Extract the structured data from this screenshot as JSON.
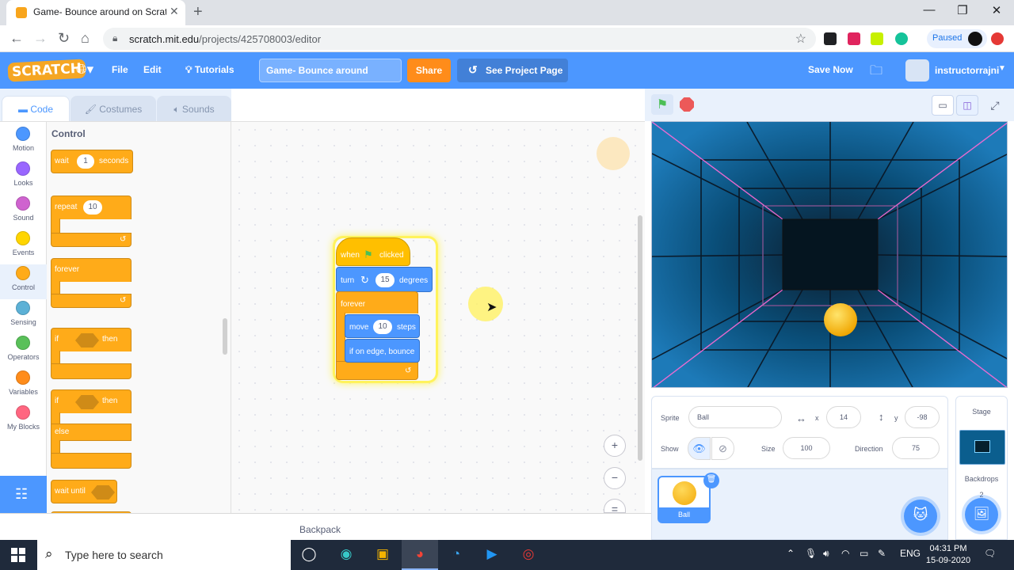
{
  "browser": {
    "tab_title": "Game- Bounce around on Scratch",
    "url_host": "scratch.mit.edu",
    "url_path": "/projects/425708003/editor",
    "profile_status": "Paused"
  },
  "menubar": {
    "logo": "SCRATCH",
    "file": "File",
    "edit": "Edit",
    "tutorials": "Tutorials",
    "project_title": "Game- Bounce around",
    "share": "Share",
    "see_project_page": "See Project Page",
    "save_now": "Save Now",
    "username": "instructorrajni"
  },
  "editor_tabs": {
    "code": "Code",
    "costumes": "Costumes",
    "sounds": "Sounds"
  },
  "categories": [
    {
      "label": "Motion",
      "color": "#4c97ff"
    },
    {
      "label": "Looks",
      "color": "#9966ff"
    },
    {
      "label": "Sound",
      "color": "#cf63cf"
    },
    {
      "label": "Events",
      "color": "#ffd500"
    },
    {
      "label": "Control",
      "color": "#ffab19"
    },
    {
      "label": "Sensing",
      "color": "#5cb1d6"
    },
    {
      "label": "Operators",
      "color": "#59c059"
    },
    {
      "label": "Variables",
      "color": "#ff8c1a"
    },
    {
      "label": "My Blocks",
      "color": "#ff6680"
    }
  ],
  "palette": {
    "heading": "Control",
    "wait": {
      "pre": "wait",
      "value": "1",
      "post": "seconds"
    },
    "repeat": {
      "label": "repeat",
      "value": "10"
    },
    "forever": "forever",
    "if_then": {
      "if": "if",
      "then": "then"
    },
    "if_else": {
      "if": "if",
      "then": "then",
      "else": "else"
    },
    "wait_until": "wait until"
  },
  "script": {
    "when_pre": "when",
    "when_post": "clicked",
    "turn_label": "turn",
    "turn_value": "15",
    "turn_unit": "degrees",
    "forever_label": "forever",
    "move_label": "move",
    "move_value": "10",
    "move_unit": "steps",
    "bounce_label": "if on edge, bounce"
  },
  "zoom": {
    "in": "+",
    "out": "−",
    "reset": "="
  },
  "backpack": "Backpack",
  "sprite_info": {
    "sprite_label": "Sprite",
    "sprite_name": "Ball",
    "x_label": "x",
    "x_value": "14",
    "y_label": "y",
    "y_value": "-98",
    "show_label": "Show",
    "size_label": "Size",
    "size_value": "100",
    "direction_label": "Direction",
    "direction_value": "75"
  },
  "sprites": [
    {
      "name": "Ball"
    }
  ],
  "stage_panel": {
    "label": "Stage",
    "backdrops_label": "Backdrops",
    "backdrop_count": "2"
  },
  "taskbar": {
    "search_placeholder": "Type here to search",
    "language": "ENG",
    "time": "04:31 PM",
    "date": "15-09-2020"
  },
  "colors": {
    "scratch_blue": "#4c97ff",
    "control_orange": "#ffab19",
    "event_yellow": "#ffbf00",
    "motion_blue": "#4c97ff",
    "share_orange": "#ff8c1a",
    "stage_bg": "#0b5e8e",
    "neon_pink": "#ff6ad5"
  }
}
